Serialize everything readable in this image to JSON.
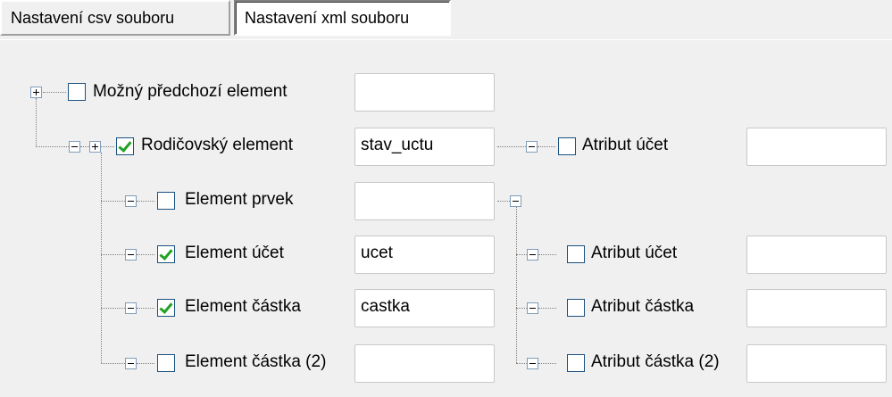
{
  "tabs": [
    {
      "label": "Nastavení csv souboru"
    },
    {
      "label": "Nastavení xml souboru"
    }
  ],
  "tree": {
    "possible_previous": {
      "label": "Možný předchozí element",
      "checked": false,
      "value": ""
    },
    "parent": {
      "label": "Rodičovský element",
      "checked": true,
      "value": "stav_uctu"
    },
    "parent_attribute": {
      "label": "Atribut účet",
      "checked": false,
      "value": ""
    },
    "elements": [
      {
        "label": "Element prvek",
        "checked": false,
        "value": ""
      },
      {
        "label": "Element účet",
        "checked": true,
        "value": "ucet"
      },
      {
        "label": "Element částka",
        "checked": true,
        "value": "castka"
      },
      {
        "label": "Element částka (2)",
        "checked": false,
        "value": ""
      }
    ],
    "attributes": [
      {
        "label": "Atribut účet",
        "checked": false,
        "value": ""
      },
      {
        "label": "Atribut částka",
        "checked": false,
        "value": ""
      },
      {
        "label": "Atribut částka (2)",
        "checked": false,
        "value": ""
      }
    ]
  },
  "icons": {
    "expand": "plus-box-icon",
    "collapse": "minus-box-icon",
    "checkbox": "checkbox-icon"
  }
}
